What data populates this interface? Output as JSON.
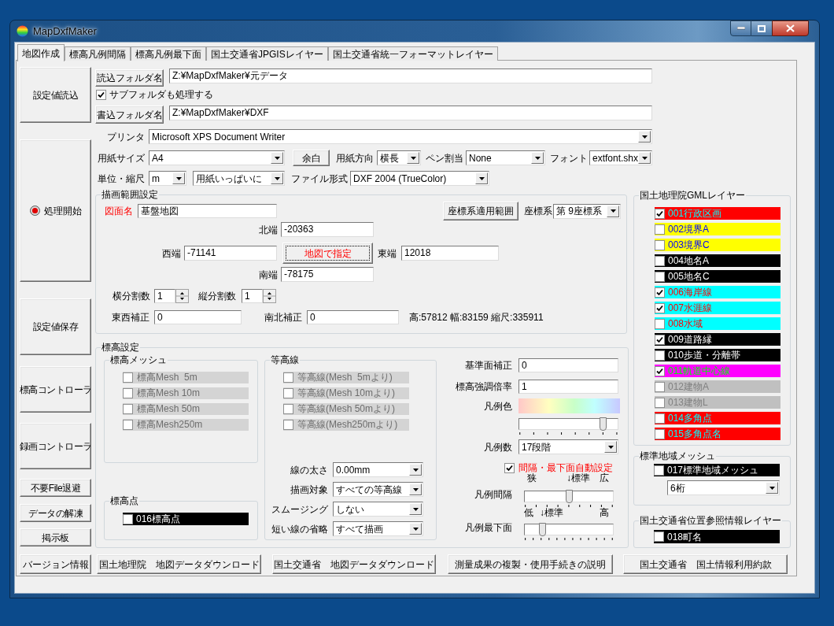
{
  "window": {
    "title": "MapDxfMaker"
  },
  "tabs": [
    {
      "label": "地図作成",
      "selected": true
    },
    {
      "label": "標高凡例間隔",
      "selected": false
    },
    {
      "label": "標高凡例最下面",
      "selected": false
    },
    {
      "label": "国土交通省JPGISレイヤー",
      "selected": false
    },
    {
      "label": "国土交通省統一フォーマットレイヤー",
      "selected": false
    }
  ],
  "side_buttons": [
    {
      "label": "設定値読込",
      "kind": "plain"
    },
    {
      "label": "処理開始",
      "kind": "start"
    },
    {
      "label": "設定値保存",
      "kind": "plain"
    },
    {
      "label": "標高コントローラ",
      "kind": "plain"
    },
    {
      "label": "録画コントローラ",
      "kind": "plain"
    },
    {
      "label": "不要File退避",
      "kind": "plain"
    },
    {
      "label": "データの解凍",
      "kind": "plain"
    },
    {
      "label": "掲示板",
      "kind": "plain"
    }
  ],
  "read_folder": {
    "button": "読込フォルダ名",
    "value": "Z:¥MapDxfMaker¥元データ"
  },
  "subfolders": {
    "label": "サブフォルダも処理する",
    "checked": true
  },
  "write_folder": {
    "button": "書込フォルダ名",
    "value": "Z:¥MapDxfMaker¥DXF"
  },
  "printer": {
    "label": "プリンタ",
    "value": "Microsoft XPS Document Writer"
  },
  "paper_size": {
    "label": "用紙サイズ",
    "value": "A4"
  },
  "margin_button": "余白",
  "orientation": {
    "label": "用紙方向",
    "value": "横長"
  },
  "pen": {
    "label": "ペン割当",
    "value": "None"
  },
  "font": {
    "label": "フォント",
    "value": "extfont.shx"
  },
  "unit_scale": {
    "label": "単位・縮尺",
    "unit": "m",
    "scale": "用紙いっぱいに"
  },
  "file_format": {
    "label": "ファイル形式",
    "value": "DXF 2004 (TrueColor)"
  },
  "extent": {
    "title": "描画範囲設定",
    "drawing_name": {
      "label": "図面名",
      "value": "基盤地図"
    },
    "range_button": "座標系適用範囲",
    "coord_system": {
      "label": "座標系",
      "value": "第 9座標系"
    },
    "north": {
      "label": "北端",
      "value": "-20363"
    },
    "west": {
      "label": "西端",
      "value": "-71141"
    },
    "map_button": "地図で指定",
    "east": {
      "label": "東端",
      "value": "12018"
    },
    "south": {
      "label": "南端",
      "value": "-78175"
    },
    "h_divisions": {
      "label": "横分割数",
      "value": "1"
    },
    "v_divisions": {
      "label": "縦分割数",
      "value": "1"
    },
    "ew_offset": {
      "label": "東西補正",
      "value": "0"
    },
    "ns_offset": {
      "label": "南北補正",
      "value": "0"
    },
    "summary": "高:57812 幅:83159 縮尺:335911"
  },
  "elevation": {
    "title": "標高設定",
    "mesh": {
      "title": "標高メッシュ",
      "items": [
        {
          "label": "標高Mesh  5m",
          "checked": false,
          "disabled": true
        },
        {
          "label": "標高Mesh 10m",
          "checked": false,
          "disabled": true
        },
        {
          "label": "標高Mesh 50m",
          "checked": false,
          "disabled": true
        },
        {
          "label": "標高Mesh250m",
          "checked": false,
          "disabled": true
        }
      ]
    },
    "points": {
      "title": "標高点",
      "item": {
        "label": "016標高点",
        "checked": false,
        "color": "#000000"
      }
    },
    "contours": {
      "title": "等高線",
      "items": [
        {
          "label": "等高線(Mesh  5mより)",
          "checked": false,
          "disabled": true
        },
        {
          "label": "等高線(Mesh 10mより)",
          "checked": false,
          "disabled": true
        },
        {
          "label": "等高線(Mesh 50mより)",
          "checked": false,
          "disabled": true
        },
        {
          "label": "等高線(Mesh250mより)",
          "checked": false,
          "disabled": true
        }
      ],
      "settings": [
        {
          "label": "線の太さ",
          "value": "0.00mm"
        },
        {
          "label": "描画対象",
          "value": "すべての等高線"
        },
        {
          "label": "スムージング",
          "value": "しない"
        },
        {
          "label": "短い線の省略",
          "value": "すべて描画"
        }
      ]
    },
    "base_offset": {
      "label": "基準面補正",
      "value": "0"
    },
    "exaggeration": {
      "label": "標高強調倍率",
      "value": "1"
    },
    "legend_color": {
      "label": "凡例色",
      "level": 0.85
    },
    "legend_count": {
      "label": "凡例数",
      "value": "17段階"
    },
    "auto_set": {
      "label": "間隔・最下面自動設定",
      "checked": true
    },
    "legend_interval": {
      "label": "凡例間隔",
      "scale": [
        "狭",
        "↓標準",
        "広"
      ],
      "level": 0.5
    },
    "legend_bottom": {
      "label": "凡例最下面",
      "scale": [
        "低",
        "↓標準",
        "高"
      ],
      "level": 0.2
    }
  },
  "gml_layers": {
    "title": "国土地理院GMLレイヤー",
    "items": [
      {
        "label": "001行政区画",
        "checked": true,
        "color": "#ff0000"
      },
      {
        "label": "002境界A",
        "checked": false,
        "color": "#ffff00"
      },
      {
        "label": "003境界C",
        "checked": false,
        "color": "#ffff00"
      },
      {
        "label": "004地名A",
        "checked": false,
        "color": "#000000"
      },
      {
        "label": "005地名C",
        "checked": false,
        "color": "#000000"
      },
      {
        "label": "006海岸線",
        "checked": true,
        "color": "#00ffff"
      },
      {
        "label": "007水涯線",
        "checked": true,
        "color": "#00ffff"
      },
      {
        "label": "008水域",
        "checked": false,
        "color": "#00ffff"
      },
      {
        "label": "009道路縁",
        "checked": true,
        "color": "#000000"
      },
      {
        "label": "010歩道・分離帯",
        "checked": false,
        "color": "#000000"
      },
      {
        "label": "011軌道中心線",
        "checked": true,
        "color": "#ff00ff"
      },
      {
        "label": "012建物A",
        "checked": false,
        "color": "#c0c0c0"
      },
      {
        "label": "013建物L",
        "checked": false,
        "color": "#c0c0c0"
      },
      {
        "label": "014多角点",
        "checked": false,
        "color": "#ff0000"
      },
      {
        "label": "015多角点名",
        "checked": false,
        "color": "#ff0000"
      }
    ]
  },
  "standard_mesh": {
    "title": "標準地域メッシュ",
    "item": {
      "label": "017標準地域メッシュ",
      "checked": false,
      "color": "#000000"
    },
    "digits": "6桁"
  },
  "location_layers": {
    "title": "国土交通省位置参照情報レイヤー",
    "item": {
      "label": "018町名",
      "checked": false,
      "color": "#000000"
    }
  },
  "bottom_buttons": [
    "バージョン情報",
    "国土地理院　地図データダウンロード",
    "国土交通省　地図データダウンロード",
    "測量成果の複製・使用手続きの説明",
    "国土交通省　国土情報利用約款"
  ]
}
